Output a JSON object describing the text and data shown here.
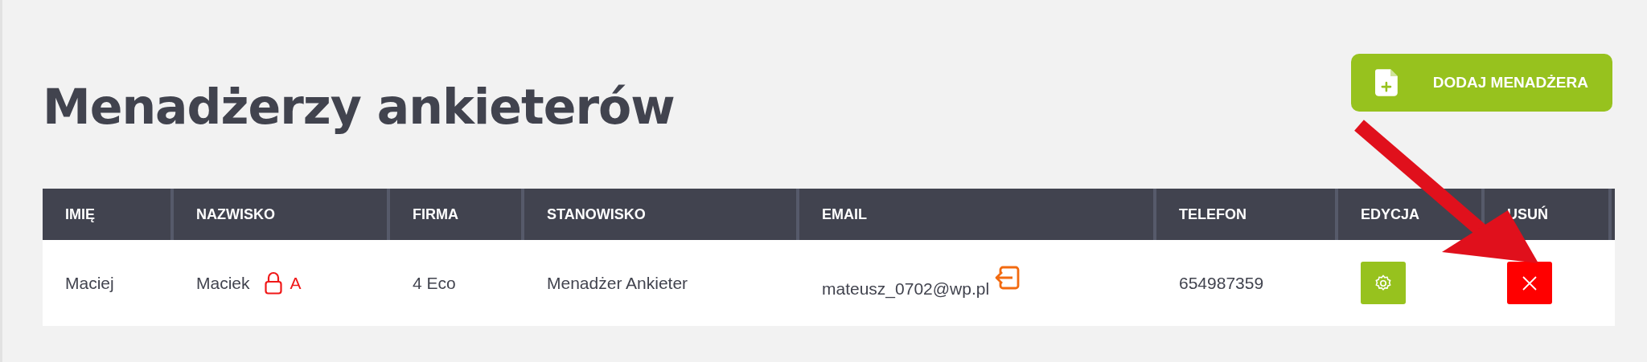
{
  "page": {
    "title": "Menadżerzy ankieterów"
  },
  "add_button": {
    "label": "DODAJ MENADŻERA"
  },
  "table": {
    "columns": [
      "IMIĘ",
      "NAZWISKO",
      "FIRMA",
      "STANOWISKO",
      "EMAIL",
      "TELEFON",
      "EDYCJA",
      "USUŃ"
    ],
    "rows": [
      {
        "first_name": "Maciej",
        "last_name": "Maciek",
        "locked": true,
        "role_badge": "A",
        "company": "4 Eco",
        "position": "Menadżer Ankieter",
        "email": "mateusz_0702@wp.pl",
        "telefon": "654987359"
      }
    ]
  }
}
